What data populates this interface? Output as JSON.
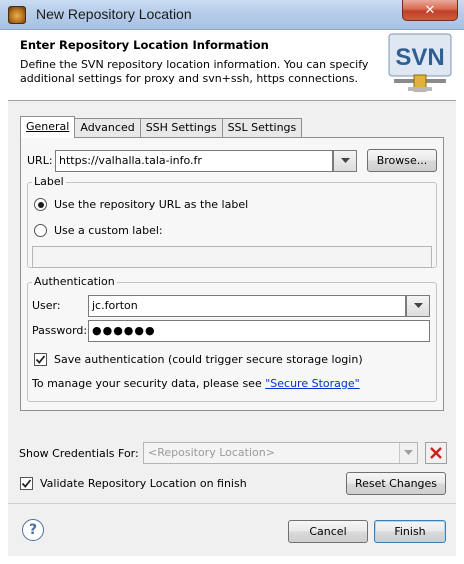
{
  "window": {
    "title": "New Repository Location",
    "close_glyph": "✕"
  },
  "header": {
    "title": "Enter Repository Location Information",
    "description": "Define the SVN repository location information. You can specify additional settings for proxy and svn+ssh, https connections.",
    "logo_text": "SVN"
  },
  "tabs": [
    {
      "label": "General",
      "mnemonic_index": 0,
      "active": true
    },
    {
      "label": "Advanced",
      "mnemonic_index": 0,
      "active": false
    },
    {
      "label": "SSH Settings",
      "mnemonic_index": 2,
      "active": false
    },
    {
      "label": "SSL Settings",
      "mnemonic_index": 2,
      "active": false
    }
  ],
  "general": {
    "url_label": "URL:",
    "url_value": "https://valhalla.tala-info.fr",
    "browse_label": "Browse...",
    "label_group": {
      "title": "Label",
      "option_repo_url": "Use the repository URL as the label",
      "option_custom": "Use a custom label:",
      "selected": "repo_url",
      "custom_value": ""
    },
    "auth_group": {
      "title": "Authentication",
      "user_label": "User:",
      "user_value": "jc.forton",
      "password_label": "Password:",
      "password_value": "●●●●●●",
      "save_auth_label": "Save authentication (could trigger secure storage login)",
      "save_auth_checked": true,
      "secure_storage_text": "To manage your security data, please see ",
      "secure_storage_link": "\"Secure Storage\""
    }
  },
  "credentials": {
    "label": "Show Credentials For:",
    "placeholder": "<Repository Location>"
  },
  "validate": {
    "label": "Validate Repository Location on finish",
    "checked": true
  },
  "buttons": {
    "reset": "Reset Changes",
    "cancel": "Cancel",
    "finish": "Finish",
    "help": "?"
  },
  "colors": {
    "link": "#0033cc",
    "close_button": "#c0402a",
    "title_bar": "#b6cde9"
  }
}
